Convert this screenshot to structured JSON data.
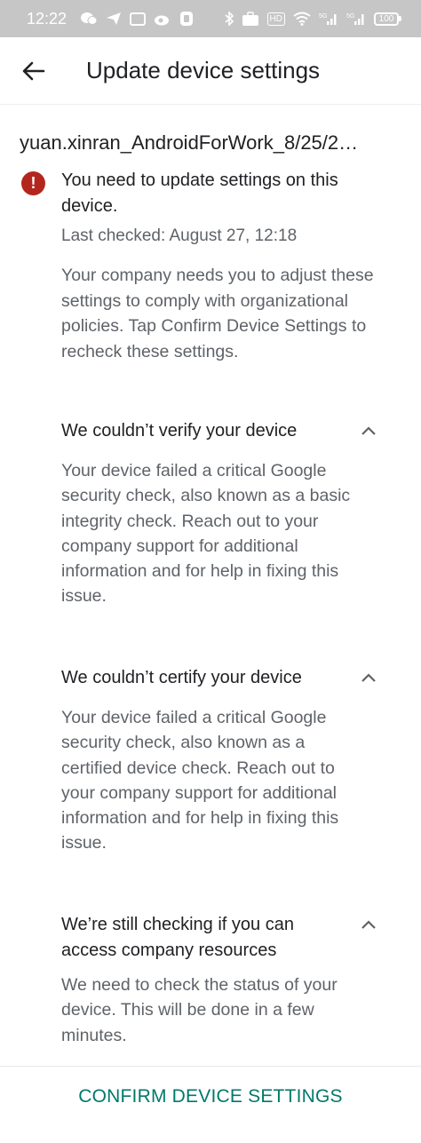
{
  "status_bar": {
    "time": "12:22",
    "network_label": "HD",
    "signal1_label": "5G",
    "signal2_label": "5G",
    "battery": "100"
  },
  "appbar": {
    "title": "Update device settings"
  },
  "device": {
    "name": "yuan.xinran_AndroidForWork_8/25/2…"
  },
  "warning": {
    "title": "You need to update settings on this device.",
    "last_checked": "Last checked: August 27, 12:18",
    "explanation": "Your company needs you to adjust these settings to comply with organizational policies. Tap Confirm Device Settings to recheck these settings."
  },
  "issues": [
    {
      "title": "We couldn’t verify your device",
      "body": "Your device failed a critical Google security check, also known as a basic integrity check. Reach out to your company support for additional information and for help in fixing this issue."
    },
    {
      "title": "We couldn’t certify your device",
      "body": "Your device failed a critical Google security check, also known as a certified device check. Reach out to your company support for additional information and for help in fixing this issue."
    },
    {
      "title": "We’re still checking if you can access company resources",
      "body": "We need to check the status of your device. This will be done in a few minutes."
    }
  ],
  "actions": {
    "confirm_label": "CONFIRM DEVICE SETTINGS"
  },
  "colors": {
    "accent": "#00796b",
    "error": "#b3261e",
    "status_bar_bg": "#c6c6c6"
  }
}
